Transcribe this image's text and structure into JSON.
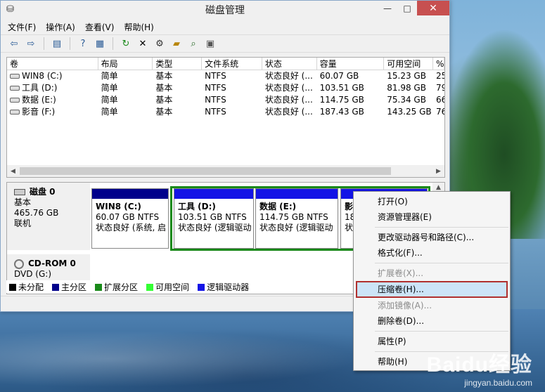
{
  "window": {
    "title": "磁盘管理",
    "controls": {
      "minimize": "—",
      "maximize": "□",
      "close": "✕"
    }
  },
  "menubar": [
    "文件(F)",
    "操作(A)",
    "查看(V)",
    "帮助(H)"
  ],
  "toolbar": [
    "back-icon",
    "forward-icon",
    "console-tree-icon",
    "help-icon",
    "properties-icon",
    "refresh-icon",
    "delete-icon",
    "settings-icon",
    "open-folder-icon",
    "search-icon",
    "export-icon"
  ],
  "volume_list": {
    "columns": [
      "卷",
      "布局",
      "类型",
      "文件系统",
      "状态",
      "容量",
      "可用空间",
      "%"
    ],
    "rows": [
      [
        "WIN8 (C:)",
        "简单",
        "基本",
        "NTFS",
        "状态良好 (...",
        "60.07 GB",
        "15.23 GB",
        "25"
      ],
      [
        "工具 (D:)",
        "简单",
        "基本",
        "NTFS",
        "状态良好 (...",
        "103.51 GB",
        "81.98 GB",
        "79"
      ],
      [
        "数据 (E:)",
        "简单",
        "基本",
        "NTFS",
        "状态良好 (...",
        "114.75 GB",
        "75.34 GB",
        "66"
      ],
      [
        "影音 (F:)",
        "简单",
        "基本",
        "NTFS",
        "状态良好 (...",
        "187.43 GB",
        "143.25 GB",
        "76"
      ]
    ]
  },
  "disk0": {
    "name": "磁盘 0",
    "type": "基本",
    "size": "465.76 GB",
    "status": "联机",
    "partitions": [
      {
        "name": "WIN8  (C:)",
        "size": "60.07 GB NTFS",
        "status": "状态良好 (系统, 启"
      },
      {
        "name": "工具  (D:)",
        "size": "103.51 GB NTFS",
        "status": "状态良好 (逻辑驱动"
      },
      {
        "name": "数据  (E:)",
        "size": "114.75 GB NTFS",
        "status": "状态良好 (逻辑驱动"
      },
      {
        "name": "影",
        "size": "18",
        "status": "状"
      }
    ]
  },
  "cdrom": {
    "name": "CD-ROM 0",
    "type": "DVD (G:)"
  },
  "legend": [
    {
      "label": "未分配",
      "color": "#000000"
    },
    {
      "label": "主分区",
      "color": "#00008b"
    },
    {
      "label": "扩展分区",
      "color": "#1a8a1a"
    },
    {
      "label": "可用空间",
      "color": "#33ff33"
    },
    {
      "label": "逻辑驱动器",
      "color": "#1414e6"
    }
  ],
  "context_menu": [
    {
      "label": "打开(O)",
      "state": "enabled"
    },
    {
      "label": "资源管理器(E)",
      "state": "enabled"
    },
    {
      "label": "更改驱动器号和路径(C)...",
      "state": "enabled"
    },
    {
      "label": "格式化(F)...",
      "state": "enabled"
    },
    {
      "label": "扩展卷(X)...",
      "state": "disabled"
    },
    {
      "label": "压缩卷(H)...",
      "state": "highlighted"
    },
    {
      "label": "添加镜像(A)...",
      "state": "disabled"
    },
    {
      "label": "删除卷(D)...",
      "state": "enabled"
    },
    {
      "label": "属性(P)",
      "state": "enabled"
    },
    {
      "label": "帮助(H)",
      "state": "enabled"
    }
  ],
  "watermark": {
    "logo": "Baidu经验",
    "url": "jingyan.baidu.com"
  }
}
